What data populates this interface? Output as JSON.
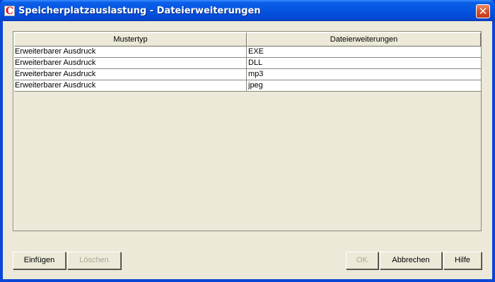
{
  "window": {
    "title": "Speicherplatzauslastung - Dateierweiterungen",
    "app_icon": "C",
    "close_icon": "close-icon",
    "colors": {
      "titlebar": "#0454e0",
      "body": "#ece9d8",
      "close": "#d8502a"
    }
  },
  "table": {
    "columns": [
      "Mustertyp",
      "Dateierweiterungen"
    ],
    "rows": [
      [
        "Erweiterbarer Ausdruck",
        "EXE"
      ],
      [
        "Erweiterbarer Ausdruck",
        "DLL"
      ],
      [
        "Erweiterbarer Ausdruck",
        "mp3"
      ],
      [
        "Erweiterbarer Ausdruck",
        "jpeg"
      ]
    ]
  },
  "buttons": {
    "insert": "Einfügen",
    "delete": "Löschen",
    "ok": "OK",
    "cancel": "Abbrechen",
    "help": "Hilfe"
  }
}
